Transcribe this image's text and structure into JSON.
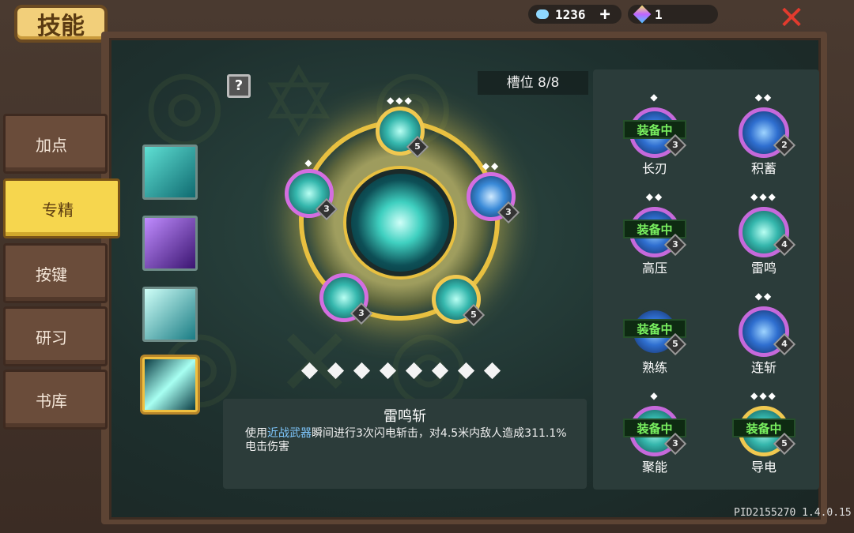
{
  "header": {
    "title": "技能",
    "gems": "1236",
    "add": "+",
    "crystals": "1",
    "close": "✕"
  },
  "tabs": [
    {
      "label": "加点"
    },
    {
      "label": "专精"
    },
    {
      "label": "按键"
    },
    {
      "label": "研习"
    },
    {
      "label": "书库"
    }
  ],
  "help": "?",
  "slots": "槽位 8/8",
  "wheel": {
    "nodes": [
      {
        "level": "5",
        "dots": "◆◆◆"
      },
      {
        "level": "3",
        "dots": "◆◆"
      },
      {
        "level": "3",
        "dots": "◆"
      },
      {
        "level": "5",
        "dots": ""
      },
      {
        "level": "3",
        "dots": ""
      }
    ]
  },
  "detail": {
    "title": "雷鸣斩",
    "text_pre": "使用",
    "text_link": "近战武器",
    "text_post": "瞬间进行3次闪电斩击，对4.5米内敌人造成311.1%电击伤害"
  },
  "equipped_tag": "装备中",
  "skills": [
    {
      "name": "长刃",
      "level": "3",
      "dots": "◆",
      "equipped": true
    },
    {
      "name": "积蓄",
      "level": "2",
      "dots": "◆◆",
      "equipped": false
    },
    {
      "name": "高压",
      "level": "3",
      "dots": "◆◆",
      "equipped": true
    },
    {
      "name": "雷鸣",
      "level": "4",
      "dots": "◆◆◆",
      "equipped": false
    },
    {
      "name": "熟练",
      "level": "5",
      "dots": "",
      "equipped": true
    },
    {
      "name": "连斩",
      "level": "4",
      "dots": "◆◆",
      "equipped": false
    },
    {
      "name": "聚能",
      "level": "3",
      "dots": "◆",
      "equipped": true
    },
    {
      "name": "导电",
      "level": "5",
      "dots": "◆◆◆",
      "equipped": true
    }
  ],
  "footer": "PID2155270 1.4.0.15",
  "colors": {
    "active_tab": "#f6d64e",
    "equipped_text": "#79f060",
    "highlight_text": "#7fc8ff",
    "close": "#e23b2e",
    "ring": "#e8c040"
  }
}
